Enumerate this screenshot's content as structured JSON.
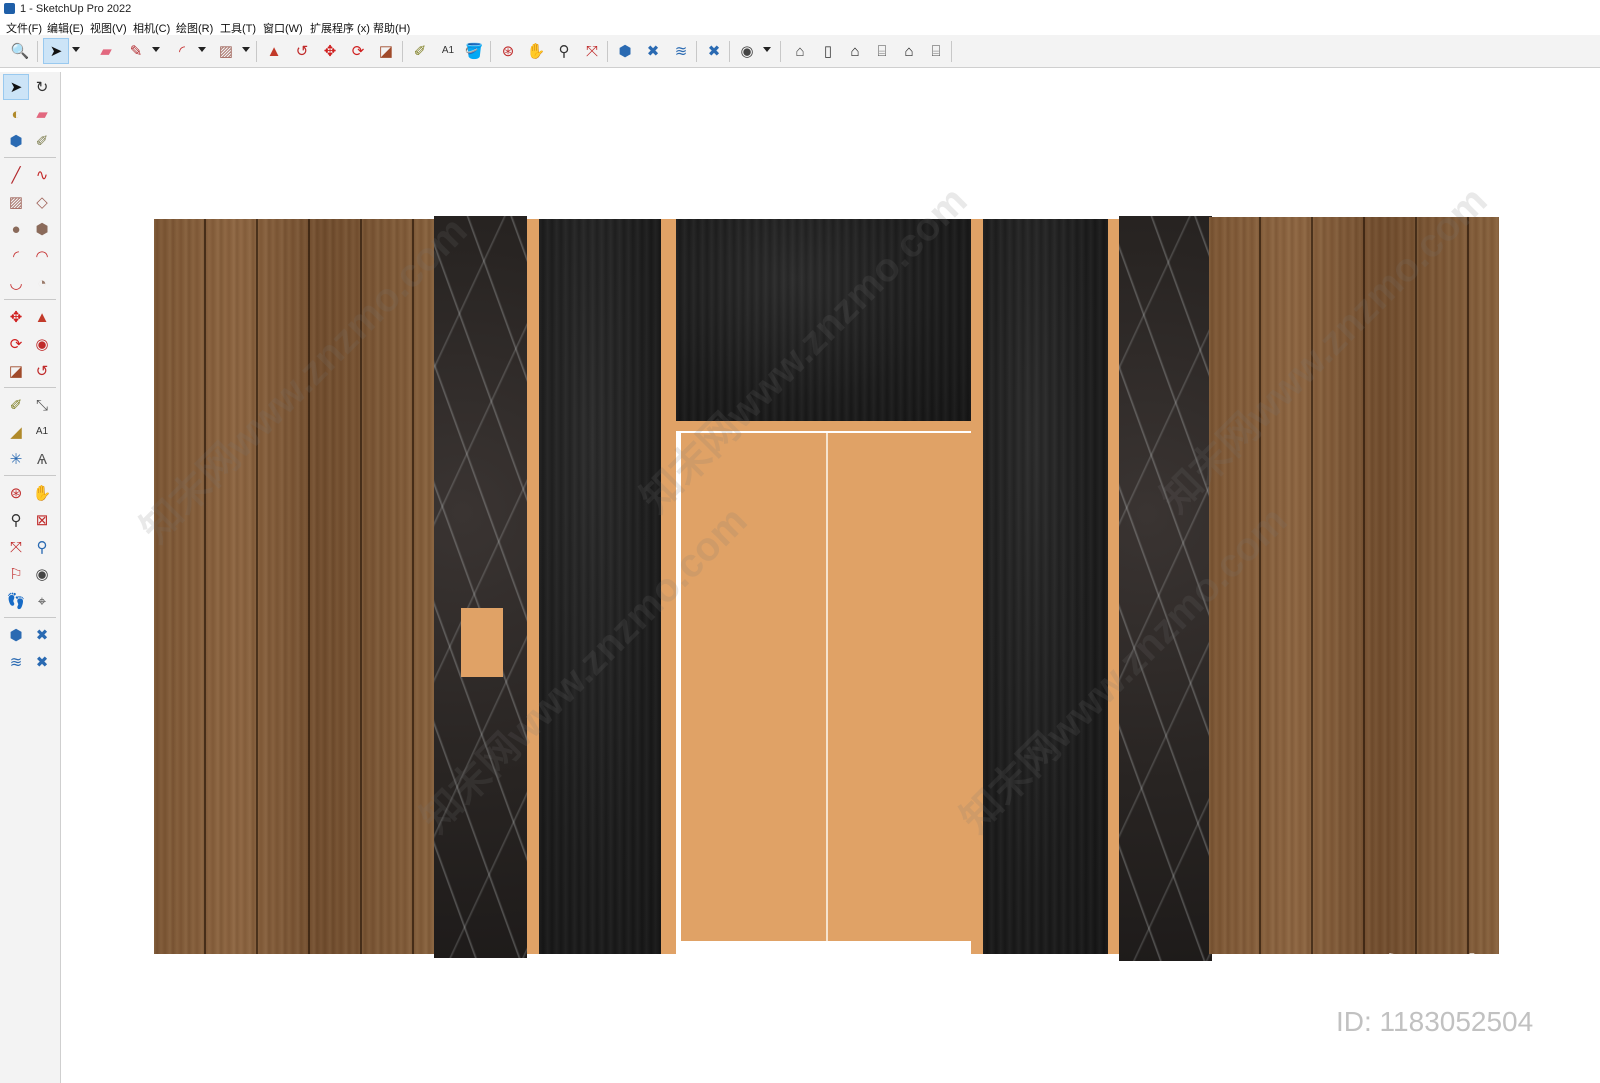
{
  "window": {
    "title": "1 - SketchUp Pro 2022"
  },
  "menu": [
    "文件(F)",
    "编辑(E)",
    "视图(V)",
    "相机(C)",
    "绘图(R)",
    "工具(T)",
    "窗口(W)",
    "扩展程序 (x)",
    "帮助(H)"
  ],
  "watermarks": {
    "text": "知末网www.znzmo.com",
    "brand": "知末",
    "id": "ID: 1183052504"
  },
  "colors": {
    "accent_selection": "#cce4f7",
    "door_orange": "#e0a266",
    "wood": "#7b5533",
    "marble": "#2a2523"
  }
}
